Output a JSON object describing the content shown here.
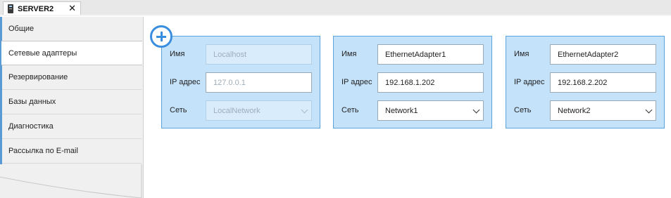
{
  "tab": {
    "title": "SERVER2",
    "close": "✕"
  },
  "nav": {
    "items": [
      {
        "label": "Общие"
      },
      {
        "label": "Сетевые адаптеры"
      },
      {
        "label": "Резервирование"
      },
      {
        "label": "Базы данных"
      },
      {
        "label": "Диагностика"
      },
      {
        "label": "Рассылка по E-mail"
      }
    ],
    "active_index": 1
  },
  "labels": {
    "name": "Имя",
    "ip": "IP адрес",
    "network": "Сеть"
  },
  "adapters": [
    {
      "name": "Localhost",
      "ip": "127.0.0.1",
      "network": "LocalNetwork",
      "disabled": true
    },
    {
      "name": "EthernetAdapter1",
      "ip": "192.168.1.202",
      "network": "Network1",
      "disabled": false
    },
    {
      "name": "EthernetAdapter2",
      "ip": "192.168.2.202",
      "network": "Network2",
      "disabled": false
    }
  ],
  "icons": {
    "add": "plus-circle-icon",
    "close": "close-icon",
    "server": "server-icon",
    "dropdown": "chevron-down-icon"
  },
  "colors": {
    "accent": "#3a8ee0",
    "card_bg": "#c4e2fa",
    "card_border": "#5aa3dd"
  }
}
